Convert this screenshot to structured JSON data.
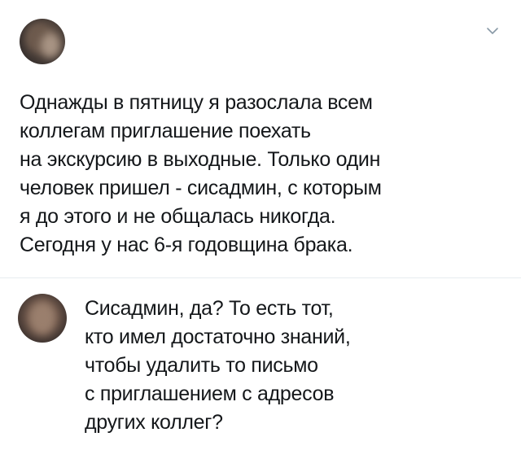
{
  "tweet": {
    "author_name": "",
    "author_handle": "",
    "menu_icon": "chevron-down-icon",
    "text_lines": [
      "Однажды в пятницу я разослала всем",
      "коллегам приглашение поехать",
      "на экскурсию в выходные. Только один",
      "человек пришел - сисадмин, с которым",
      "я до этого и не общалась никогда.",
      "Сегодня у нас 6-я годовщина брака."
    ]
  },
  "reply": {
    "text_lines": [
      "Сисадмин, да? То есть тот,",
      "кто имел достаточно знаний,",
      "чтобы удалить то письмо",
      "с приглашением с адресов",
      "других коллег?"
    ]
  },
  "colors": {
    "text": "#14171a",
    "divider": "#e6ecf0",
    "chevron": "#8899a6"
  }
}
